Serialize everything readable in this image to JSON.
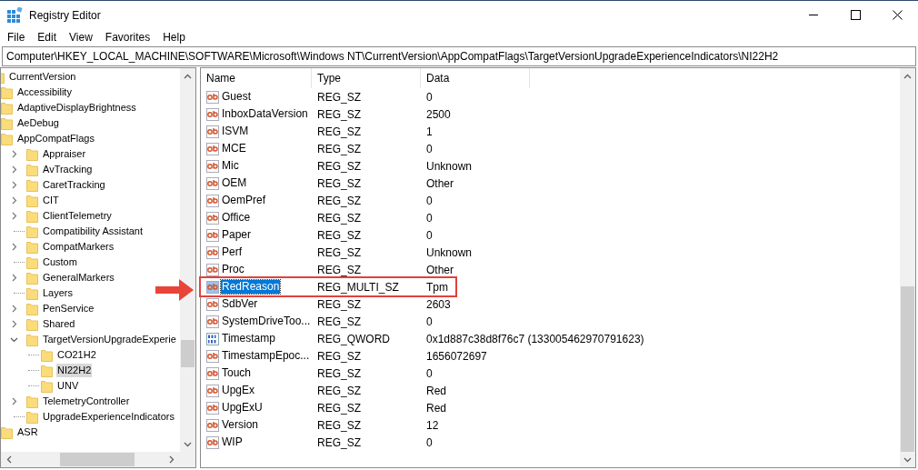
{
  "window": {
    "title": "Registry Editor"
  },
  "menu": [
    "File",
    "Edit",
    "View",
    "Favorites",
    "Help"
  ],
  "address": "Computer\\HKEY_LOCAL_MACHINE\\SOFTWARE\\Microsoft\\Windows NT\\CurrentVersion\\AppCompatFlags\\TargetVersionUpgradeExperienceIndicators\\NI22H2",
  "tree": [
    {
      "label": "CurrentVersion",
      "selected": false,
      "children": [
        {
          "label": "Accessibility",
          "selected": false
        },
        {
          "label": "AdaptiveDisplayBrightness",
          "selected": false
        },
        {
          "label": "AeDebug",
          "selected": false
        },
        {
          "label": "AppCompatFlags",
          "selected": false,
          "children": [
            {
              "label": "Appraiser",
              "kind": "branch",
              "expanded": false,
              "selected": false
            },
            {
              "label": "AvTracking",
              "kind": "branch",
              "expanded": false,
              "selected": false
            },
            {
              "label": "CaretTracking",
              "kind": "branch",
              "expanded": false,
              "selected": false
            },
            {
              "label": "CIT",
              "kind": "branch",
              "expanded": false,
              "selected": false
            },
            {
              "label": "ClientTelemetry",
              "kind": "branch",
              "expanded": false,
              "selected": false
            },
            {
              "label": "Compatibility Assistant",
              "kind": "leaf",
              "selected": false
            },
            {
              "label": "CompatMarkers",
              "kind": "branch",
              "expanded": false,
              "selected": false
            },
            {
              "label": "Custom",
              "kind": "leaf",
              "selected": false
            },
            {
              "label": "GeneralMarkers",
              "kind": "branch",
              "expanded": false,
              "selected": false
            },
            {
              "label": "Layers",
              "kind": "leaf",
              "selected": false
            },
            {
              "label": "PenService",
              "kind": "branch",
              "expanded": false,
              "selected": false
            },
            {
              "label": "Shared",
              "kind": "branch",
              "expanded": false,
              "selected": false
            },
            {
              "label": "TargetVersionUpgradeExperie",
              "kind": "branch",
              "expanded": true,
              "selected": false,
              "children": [
                {
                  "label": "CO21H2",
                  "kind": "leaf",
                  "selected": false
                },
                {
                  "label": "NI22H2",
                  "kind": "leaf",
                  "selected": true
                },
                {
                  "label": "UNV",
                  "kind": "leaf",
                  "selected": false
                }
              ]
            },
            {
              "label": "TelemetryController",
              "kind": "branch",
              "expanded": false,
              "selected": false
            },
            {
              "label": "UpgradeExperienceIndicators",
              "kind": "leaf",
              "selected": false
            }
          ]
        },
        {
          "label": "ASR",
          "selected": false
        }
      ]
    }
  ],
  "table": {
    "columns": [
      "Name",
      "Type",
      "Data"
    ],
    "rows": [
      {
        "kind": "string",
        "name": "Guest",
        "type": "REG_SZ",
        "data": "0",
        "selected": false,
        "outlined": false
      },
      {
        "kind": "string",
        "name": "InboxDataVersion",
        "type": "REG_SZ",
        "data": "2500",
        "selected": false,
        "outlined": false
      },
      {
        "kind": "string",
        "name": "ISVM",
        "type": "REG_SZ",
        "data": "1",
        "selected": false,
        "outlined": false
      },
      {
        "kind": "string",
        "name": "MCE",
        "type": "REG_SZ",
        "data": "0",
        "selected": false,
        "outlined": false
      },
      {
        "kind": "string",
        "name": "Mic",
        "type": "REG_SZ",
        "data": "Unknown",
        "selected": false,
        "outlined": false
      },
      {
        "kind": "string",
        "name": "OEM",
        "type": "REG_SZ",
        "data": "Other",
        "selected": false,
        "outlined": false
      },
      {
        "kind": "string",
        "name": "OemPref",
        "type": "REG_SZ",
        "data": "0",
        "selected": false,
        "outlined": false
      },
      {
        "kind": "string",
        "name": "Office",
        "type": "REG_SZ",
        "data": "0",
        "selected": false,
        "outlined": false
      },
      {
        "kind": "string",
        "name": "Paper",
        "type": "REG_SZ",
        "data": "0",
        "selected": false,
        "outlined": false
      },
      {
        "kind": "string",
        "name": "Perf",
        "type": "REG_SZ",
        "data": "Unknown",
        "selected": false,
        "outlined": false
      },
      {
        "kind": "string",
        "name": "Proc",
        "type": "REG_SZ",
        "data": "Other",
        "selected": false,
        "outlined": false
      },
      {
        "kind": "string",
        "name": "RedReason",
        "type": "REG_MULTI_SZ",
        "data": "Tpm",
        "selected": true,
        "outlined": true
      },
      {
        "kind": "string",
        "name": "SdbVer",
        "type": "REG_SZ",
        "data": "2603",
        "selected": false,
        "outlined": false
      },
      {
        "kind": "string",
        "name": "SystemDriveToo...",
        "type": "REG_SZ",
        "data": "0",
        "selected": false,
        "outlined": false
      },
      {
        "kind": "binary",
        "name": "Timestamp",
        "type": "REG_QWORD",
        "data": "0x1d887c38d8f76c7 (133005462970791623)",
        "selected": false,
        "outlined": false
      },
      {
        "kind": "string",
        "name": "TimestampEpoc...",
        "type": "REG_SZ",
        "data": "1656072697",
        "selected": false,
        "outlined": false
      },
      {
        "kind": "string",
        "name": "Touch",
        "type": "REG_SZ",
        "data": "0",
        "selected": false,
        "outlined": false
      },
      {
        "kind": "string",
        "name": "UpgEx",
        "type": "REG_SZ",
        "data": "Red",
        "selected": false,
        "outlined": false
      },
      {
        "kind": "string",
        "name": "UpgExU",
        "type": "REG_SZ",
        "data": "Red",
        "selected": false,
        "outlined": false
      },
      {
        "kind": "string",
        "name": "Version",
        "type": "REG_SZ",
        "data": "12",
        "selected": false,
        "outlined": false
      },
      {
        "kind": "string",
        "name": "WIP",
        "type": "REG_SZ",
        "data": "0",
        "selected": false,
        "outlined": false
      }
    ]
  }
}
